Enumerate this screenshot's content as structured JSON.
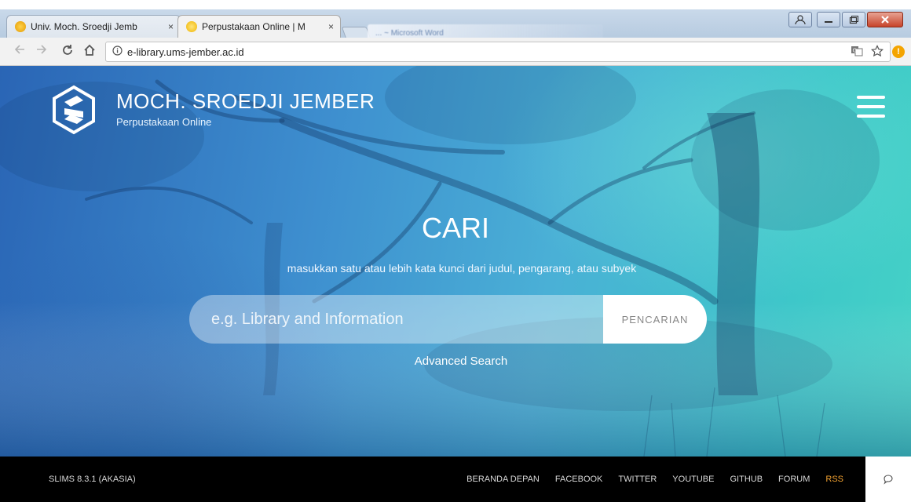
{
  "browser": {
    "tabs": [
      {
        "label": "Univ. Moch. Sroedji Jemb",
        "active": false
      },
      {
        "label": "Perpustakaan Online | M",
        "active": true
      }
    ],
    "background_tab_label": "... ~ Microsoft Word",
    "tab_close_glyph": "×",
    "url": "e-library.ums-jember.ac.id",
    "icons": [
      "back-icon",
      "forward-icon",
      "reload-icon",
      "home-icon",
      "info-icon",
      "translate-icon",
      "star-icon",
      "extension-alert-icon"
    ]
  },
  "header": {
    "title": "MOCH. SROEDJI JEMBER",
    "subtitle": "Perpustakaan Online",
    "logo_icon": "library-logo-icon",
    "menu_icon": "hamburger-menu-icon"
  },
  "search": {
    "heading": "CARI",
    "hint": "masukkan satu atau lebih kata kunci dari judul, pengarang, atau subyek",
    "placeholder": "e.g. Library and Information",
    "button_label": "PENCARIAN",
    "advanced_link": "Advanced Search"
  },
  "footer": {
    "version": "SLIMS 8.3.1 (AKASIA)",
    "links": [
      "BERANDA DEPAN",
      "FACEBOOK",
      "TWITTER",
      "YOUTUBE",
      "GITHUB",
      "FORUM",
      "RSS"
    ],
    "chat_icon": "chat-bubble-icon"
  },
  "colors": {
    "hero_start": "#2a65b5",
    "hero_end": "#45d2c6",
    "footer_bg": "#000000",
    "rss_accent": "#f0a030"
  }
}
